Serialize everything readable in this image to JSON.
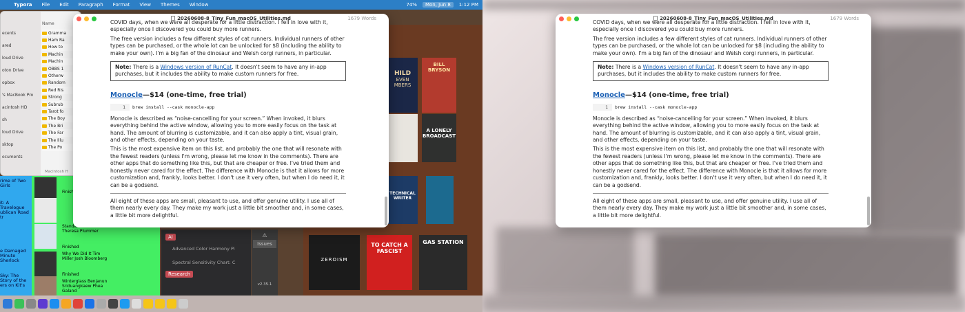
{
  "menubar": {
    "app": "Typora",
    "items": [
      "File",
      "Edit",
      "Paragraph",
      "Format",
      "View",
      "Themes",
      "Window"
    ],
    "battery": "74%",
    "date": "Mon, Jun 8",
    "time": "1:12 PM"
  },
  "finder": {
    "header": "Name",
    "sidebar": [
      "ecents",
      "ared",
      "loud Drive",
      "oton Drive",
      "opbox",
      "'s MacBook Pro",
      "acintosh HD",
      "sh",
      "loud Drive",
      "sktop",
      "ocuments"
    ],
    "files": [
      "Gramma",
      "Ham Ra",
      "How to",
      "Machin",
      "Machin",
      "OBBS 1",
      "Otherw",
      "Random",
      "Red Ris",
      "Strong",
      "Subrub",
      "Tarot fo",
      "The Boy",
      "The Bri",
      "The Far",
      "The Illu",
      "The Po"
    ],
    "footer": "Macintosh H"
  },
  "sheet": {
    "colA": [
      "rime of Two Girls",
      "it: A Travelogue ublican Road tr",
      "e Damaged Minute Sherlock",
      "Sky: The Story of the ers on Kit's"
    ],
    "cells": [
      "Finished",
      "Standard Kathleen Rea Theresa Plummer",
      "Finished",
      "Why We Did It Tim Miller Josh Bloomberg",
      "Finished",
      "Winterglass Benjanun Sriduangkaew Phea Galand",
      "Finished"
    ]
  },
  "notes": {
    "tag_ai": "AI",
    "rows": [
      "Advanced Color Harmony Pi",
      "Spectral Sensitivity Chart: C"
    ],
    "tag_research": "Research",
    "issues": "Issues",
    "version": "v2.35.1"
  },
  "document": {
    "title": "20260608-8_Tiny_Fun_macOS_Utilities.md",
    "word_count": "1679 Words",
    "para_intro": "COVID days, when we were all desperate for a little distraction. I fell in love with it, especially once I discovered you could buy more runners.",
    "para_free": "The free version includes a few different styles of cat runners. Individual runners of other types can be purchased, or the whole lot can be unlocked for $8 (including the ability to make your own). I'm a big fan of the dinosaur and Welsh corgi runners, in particular.",
    "note_label": "Note:",
    "note_pre": "There is a",
    "note_link": "Windows version of RunCat",
    "note_post": ". It doesn't seem to have any in-app purchases, but it includes the ability to make custom runners for free.",
    "heading_link": "Monocle",
    "heading_rest": "—$14 (one-time, free trial)",
    "code_line_no": "1",
    "code": "brew install --cask monocle-app",
    "para_monocle": "Monocle is described as “noise-cancelling for your screen.” When invoked, it blurs everything behind the active window, allowing you to more easily focus on the task at hand. The amount of blurring is customizable, and it can also apply a tint, visual grain, and other effects, depending on your taste.",
    "para_expensive": "This is the most expensive item on this list, and probably the one that will resonate with the fewest readers (unless I'm wrong, please let me know in the comments). There are other apps that do something like this, but that are cheaper or free. I've tried them and honestly never cared for the effect. The difference with Monocle is that it allows for more customization and, frankly, looks better. I don't use it very often, but when I do need it, it can be a godsend.",
    "para_final": "All eight of these apps are small, pleasant to use, and offer genuine utility. I use all of them nearly every day. They make my work just a little bit smoother and, in some cases, a little bit more delightful."
  },
  "books": [
    "HILD",
    "EVEN MBERS",
    "BILL BRYSON",
    "A LONELY BROADCAST",
    "ZEROISM",
    "TO CATCH A FASCIST",
    "GAS STATION",
    "TECHNICAL WRITER"
  ],
  "colors": {
    "menubar": "#2c7fc6",
    "sheet_green": "#44ee63",
    "sheet_blue": "#30a8ee",
    "link": "#1a5fb4"
  }
}
